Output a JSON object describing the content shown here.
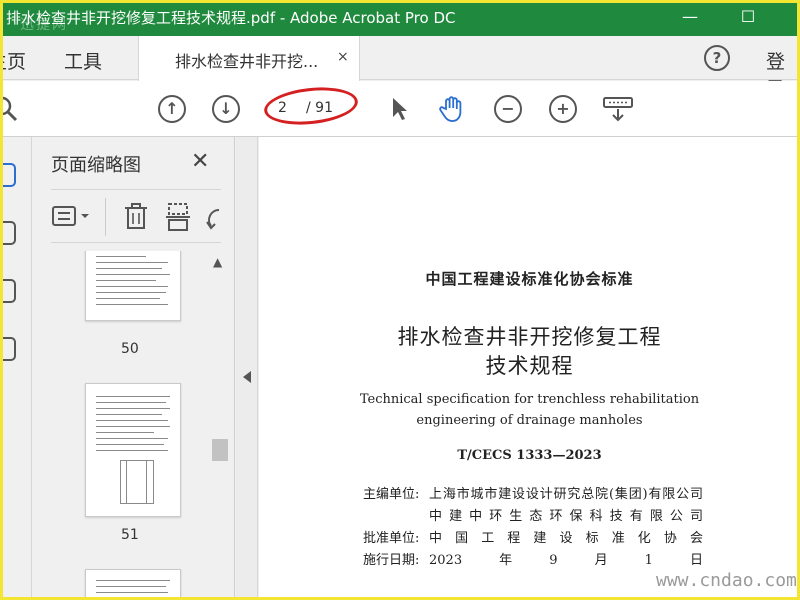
{
  "window": {
    "title": "排水检查井非开挖修复工程技术规程.pdf - Adobe Acrobat Pro DC",
    "minimize": "—",
    "maximize": "☐",
    "watermark": "迅捷网"
  },
  "tabs": {
    "home": "主页",
    "tools": "工具",
    "document": "排水检查井非开挖...",
    "close": "×",
    "help": "?",
    "login": "登录"
  },
  "toolbar": {
    "current_page": "2",
    "total_pages": "/ 91"
  },
  "panel": {
    "title": "页面缩略图",
    "close": "✕",
    "thumbnails": [
      {
        "page": "50"
      },
      {
        "page": "51"
      }
    ]
  },
  "document": {
    "org": "中国工程建设标准化协会标准",
    "title_line1": "排水检查井非开挖修复工程",
    "title_line2": "技术规程",
    "english_line1": "Technical specification for trenchless rehabilitation",
    "english_line2": "engineering of drainage manholes",
    "code": "T/CECS 1333—2023",
    "info": [
      {
        "key": "主编单位:",
        "value": "上海市城市建设设计研究总院(集团)有限公司"
      },
      {
        "key": "",
        "value": "中建中环生态环保科技有限公司"
      },
      {
        "key": "批准单位:",
        "value": "中国工程建设标准化协会"
      },
      {
        "key": "施行日期:",
        "value": "2023年9月1日"
      }
    ]
  },
  "watermark_bottom": "www.cndao.com",
  "colors": {
    "titlebar": "#1f8a3e",
    "accent": "#2a6ecf",
    "annotation": "#d42020",
    "frame": "#f3e632"
  }
}
